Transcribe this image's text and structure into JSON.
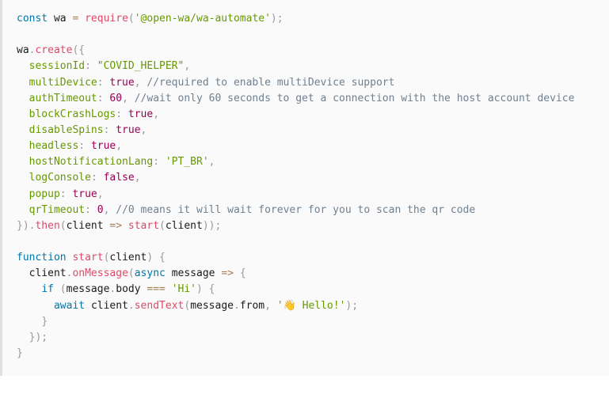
{
  "code": {
    "require_module": "'@open-wa/wa-automate'",
    "config": {
      "sessionId": "\"COVID_HELPER\"",
      "multiDevice": "true",
      "multiDevice_comment": "//required to enable multiDevice support",
      "authTimeout": "60",
      "authTimeout_comment": "//wait only 60 seconds to get a connection with the host account device",
      "blockCrashLogs": "true",
      "disableSpins": "true",
      "headless": "true",
      "hostNotificationLang": "'PT_BR'",
      "logConsole": "false",
      "popup": "true",
      "qrTimeout": "0",
      "qrTimeout_comment": "//0 means it will wait forever for you to scan the qr code"
    },
    "message_check": "'Hi'",
    "reply_text": "'👋 Hello!'"
  }
}
